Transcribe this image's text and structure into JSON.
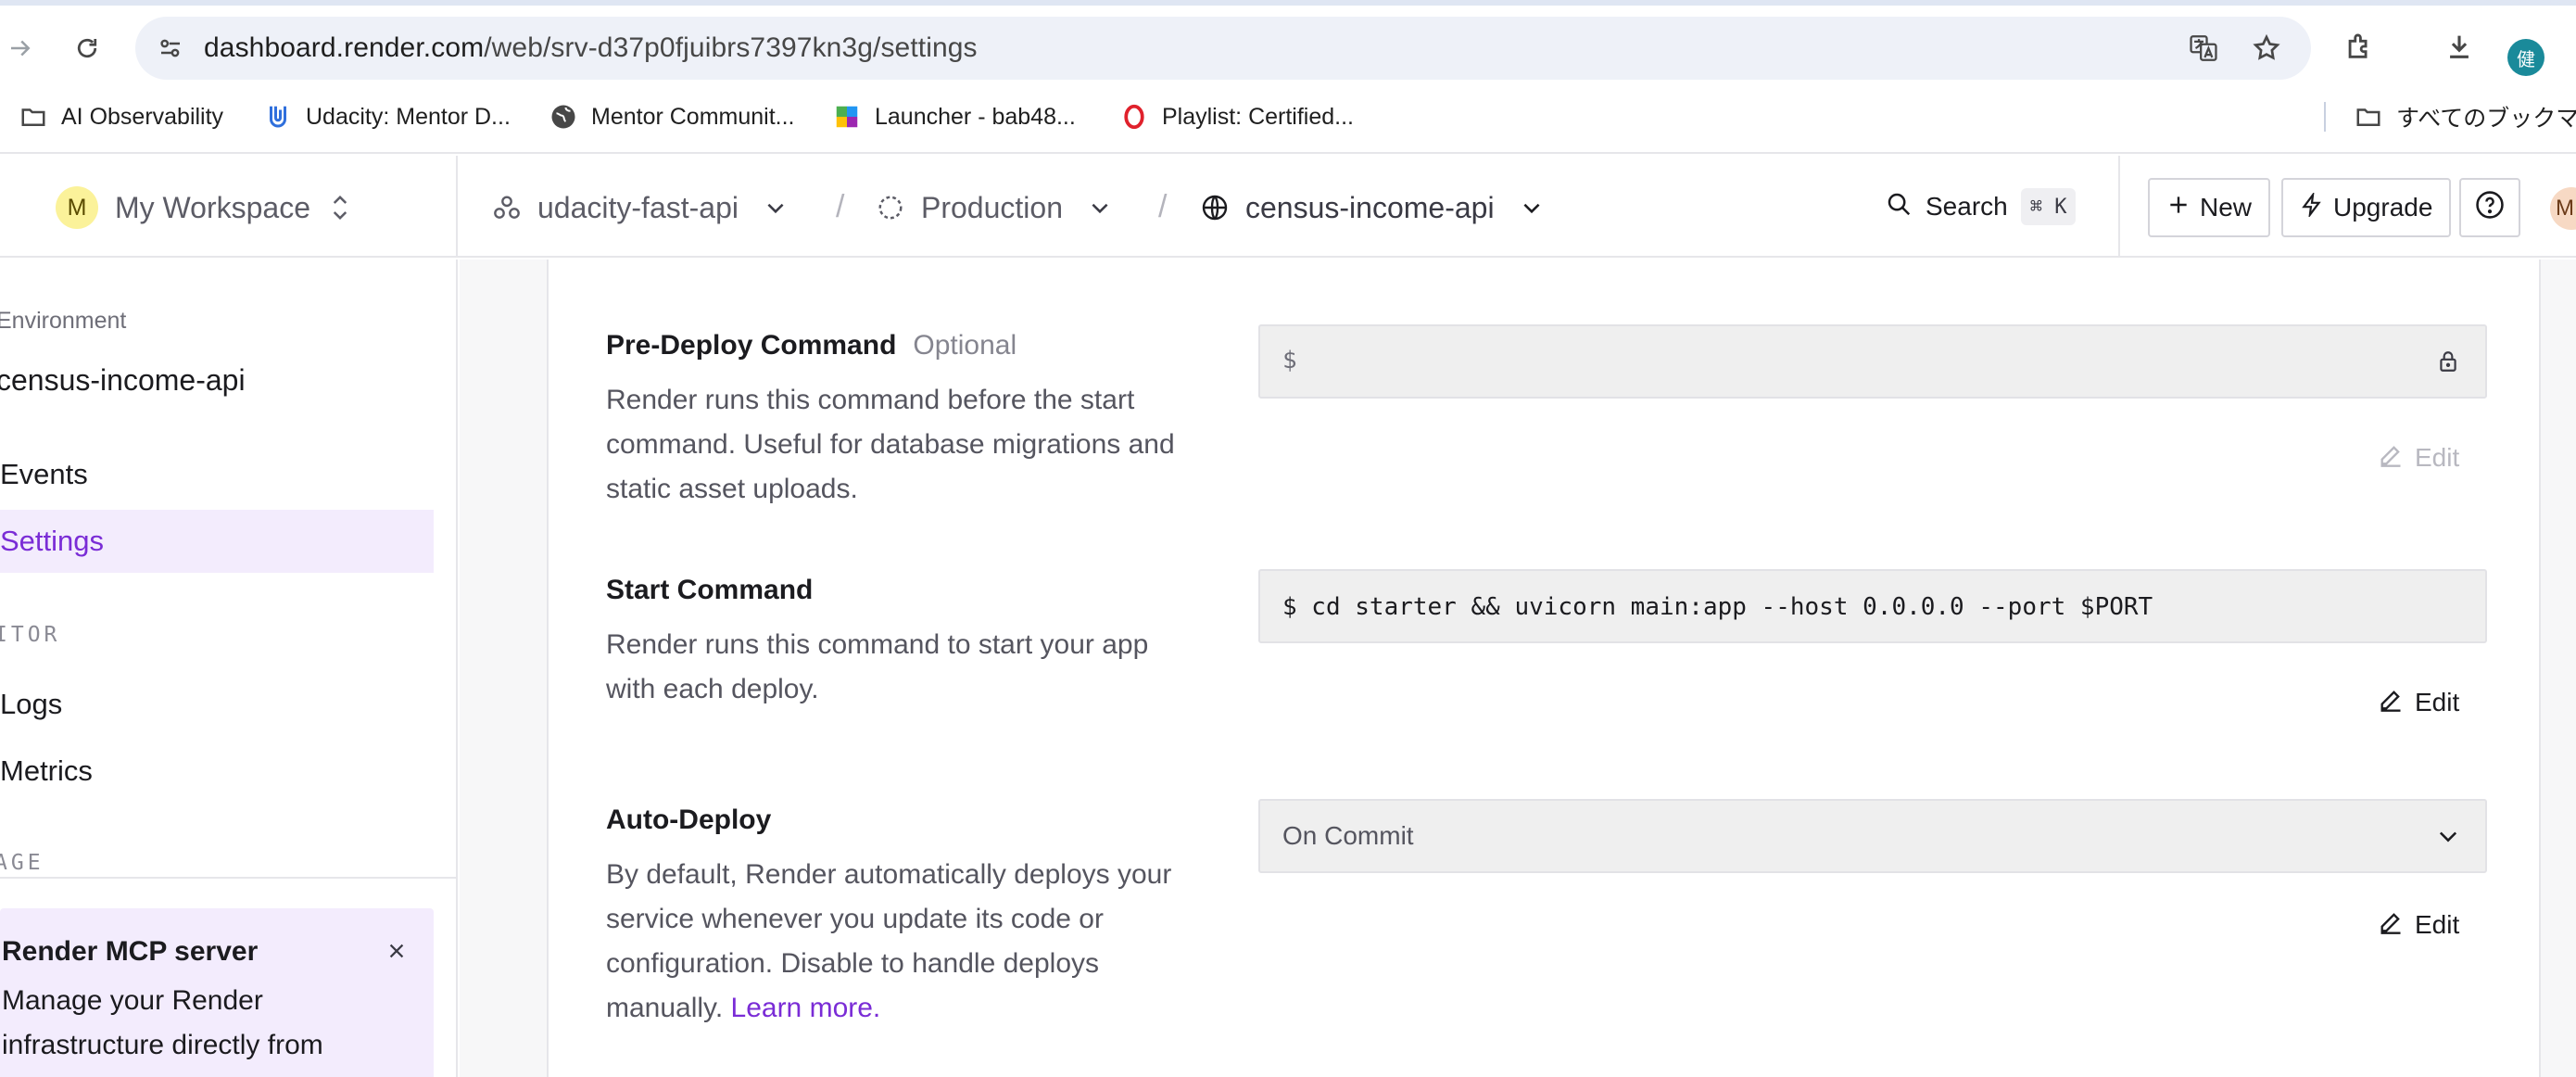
{
  "browser": {
    "url_host": "dashboard.render.com",
    "url_path": "/web/srv-d37p0fjuibrs7397kn3g/settings",
    "profile_initial": "健",
    "bookmarks": [
      {
        "label": "AI Observability",
        "icon": "folder-icon"
      },
      {
        "label": "Udacity: Mentor D...",
        "icon": "udacity-icon"
      },
      {
        "label": "Mentor Communit...",
        "icon": "globe-icon"
      },
      {
        "label": "Launcher - bab48...",
        "icon": "launcher-icon"
      },
      {
        "label": "Playlist: Certified...",
        "icon": "opera-icon"
      }
    ],
    "all_bookmarks_label": "すべてのブックマー"
  },
  "header": {
    "workspace_initial": "M",
    "workspace_name": "My Workspace",
    "project": "udacity-fast-api",
    "environment": "Production",
    "service": "census-income-api",
    "search_label": "Search",
    "search_shortcut": "⌘ K",
    "new_label": "New",
    "upgrade_label": "Upgrade",
    "user_initial": "M"
  },
  "sidebar": {
    "env_label": "Environment",
    "service_name": "census-income-api",
    "items": [
      {
        "label": "Events",
        "active": false
      },
      {
        "label": "Settings",
        "active": true
      },
      {
        "label": "Logs",
        "active": false
      },
      {
        "label": "Metrics",
        "active": false
      }
    ],
    "section_monitor": "ITOR",
    "section_manage": "AGE",
    "mcp": {
      "title": "Render MCP server",
      "body": "Manage your Render infrastructure directly from compatible AI"
    }
  },
  "settings": {
    "pre_deploy": {
      "title": "Pre-Deploy Command",
      "optional": "Optional",
      "description": "Render runs this command before the start command. Useful for database migrations and static asset uploads.",
      "value": "$",
      "edit_label": "Edit"
    },
    "start": {
      "title": "Start Command",
      "description": "Render runs this command to start your app with each deploy.",
      "value": "$ cd starter && uvicorn main:app --host 0.0.0.0 --port $PORT",
      "edit_label": "Edit"
    },
    "auto_deploy": {
      "title": "Auto-Deploy",
      "description": "By default, Render automatically deploys your service whenever you update its code or configuration. Disable to handle deploys manually.",
      "learn_more": "Learn more.",
      "value": "On Commit",
      "edit_label": "Edit"
    }
  },
  "colors": {
    "accent": "#7a2cd6",
    "active_bg": "#f3ecfd",
    "field_bg": "#efefef"
  }
}
